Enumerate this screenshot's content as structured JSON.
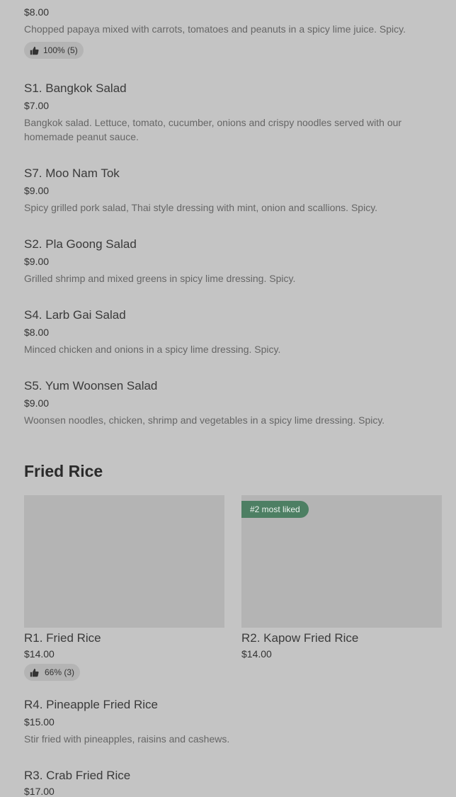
{
  "papaya": {
    "price": "$8.00",
    "description": "Chopped papaya mixed with carrots, tomatoes and peanuts in a spicy lime juice. Spicy.",
    "rating": "100% (5)"
  },
  "salads": [
    {
      "name": "S1. Bangkok Salad",
      "price": "$7.00",
      "description": "Bangkok salad. Lettuce, tomato, cucumber, onions and crispy noodles served with our homemade peanut sauce."
    },
    {
      "name": "S7. Moo Nam Tok",
      "price": "$9.00",
      "description": "Spicy grilled pork salad, Thai style dressing with mint, onion and scallions. Spicy."
    },
    {
      "name": "S2. Pla Goong Salad",
      "price": "$9.00",
      "description": "Grilled shrimp and mixed greens in spicy lime dressing. Spicy."
    },
    {
      "name": "S4. Larb Gai Salad",
      "price": "$8.00",
      "description": "Minced chicken and onions in a spicy lime dressing. Spicy."
    },
    {
      "name": "S5. Yum Woonsen Salad",
      "price": "$9.00",
      "description": "Woonsen noodles, chicken, shrimp and vegetables in a spicy lime dressing. Spicy."
    }
  ],
  "fried_rice": {
    "heading": "Fried Rice",
    "cards": [
      {
        "name": "R1. Fried Rice",
        "price": "$14.00",
        "rating": "66% (3)"
      },
      {
        "name": "R2. Kapow Fried Rice",
        "price": "$14.00",
        "badge": "#2 most liked"
      }
    ],
    "items": [
      {
        "name": "R4. Pineapple Fried Rice",
        "price": "$15.00",
        "description": "Stir fried with pineapples, raisins and cashews."
      },
      {
        "name": "R3. Crab Fried Rice",
        "price": "$17.00"
      }
    ]
  },
  "icons": {
    "thumbs_up": "thumbs-up-icon"
  },
  "colors": {
    "background": "#c4c4c4",
    "placeholder": "#b4b4b4",
    "badge_green": "#4d7f63"
  }
}
